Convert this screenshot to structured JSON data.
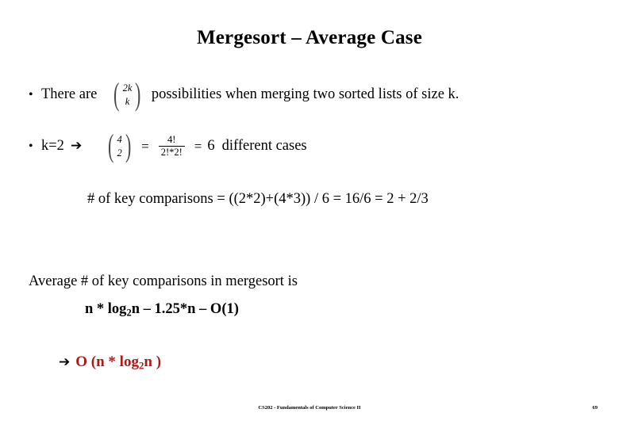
{
  "slide": {
    "title": "Mergesort – Average Case",
    "accent_color": "#B01818",
    "text_color": "#000000",
    "background_color": "#FFFFFF"
  },
  "bullets": [
    {
      "marker": "•",
      "text_before": "There are",
      "binomial": {
        "top": "2k",
        "bottom": "k"
      },
      "text_after": "possibilities when merging two sorted lists of size k."
    },
    {
      "marker": "•",
      "text_before": "k=2",
      "arrow": "➔",
      "binomial": {
        "top": "4",
        "bottom": "2"
      },
      "equals_1": "=",
      "fraction": {
        "numerator": "4!",
        "denominator": "2!*2!"
      },
      "equals_2": "=",
      "result": "6",
      "text_after": "different cases"
    }
  ],
  "body": {
    "comparisons_line": "# of key comparisons = ((2*2)+(4*3)) / 6 =  16/6  =  2 + 2/3",
    "average_line": "Average # of key comparisons in mergesort is",
    "formula": {
      "part_1": "n  * log",
      "sub_1": "2",
      "part_2": "n – 1.25*n – O(1)"
    },
    "conclusion": {
      "arrow": "➔",
      "part_1": "O (n  * log",
      "sub_1": "2",
      "part_2": "n )"
    }
  },
  "footer": {
    "text": "CS202 - Fundamentals of Computer Science II",
    "page_number": "69"
  }
}
